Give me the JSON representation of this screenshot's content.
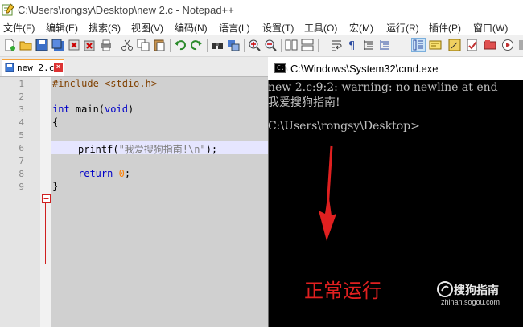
{
  "window": {
    "title": "C:\\Users\\rongsy\\Desktop\\new 2.c - Notepad++"
  },
  "menu": {
    "items": [
      "文件(F)",
      "编辑(E)",
      "搜索(S)",
      "视图(V)",
      "编码(N)",
      "语言(L)",
      "设置(T)",
      "工具(O)",
      "宏(M)",
      "运行(R)",
      "插件(P)",
      "窗口(W)"
    ]
  },
  "tab": {
    "label": "new 2.c",
    "close": "×"
  },
  "editor": {
    "line_numbers": [
      "1",
      "2",
      "3",
      "4",
      "5",
      "6",
      "7",
      "8",
      "9"
    ],
    "fold_marks": [
      "⊟"
    ],
    "code": {
      "l1_include": "#include",
      "l1_header": " <stdio.h>",
      "l3_int": "int",
      "l3_main": " main(",
      "l3_void": "void",
      "l3_close": ")",
      "l4_brace": "{",
      "l6_printf": "printf(",
      "l6_string": "\"我爱搜狗指南!\\n\"",
      "l6_end": ");",
      "l8_return": "return",
      "l8_zero": " 0",
      "l8_semi": ";",
      "l9_brace": "}"
    }
  },
  "cmd": {
    "title": "C:\\Windows\\System32\\cmd.exe",
    "icon_text": "C:\\",
    "lines": [
      "new 2.c:9:2: warning: no newline at end",
      "我爱搜狗指南!",
      "",
      "C:\\Users\\rongsy\\Desktop>"
    ]
  },
  "annotation": {
    "text": "正常运行",
    "color": "#e02020"
  },
  "watermark": {
    "brand": "搜狗指南",
    "url": "zhinan.sogou.com"
  },
  "colors": {
    "keyword": "#0000c8",
    "preprocessor": "#804000",
    "string": "#808080",
    "number": "#ff8000",
    "tab_accent": "#f7a239"
  }
}
